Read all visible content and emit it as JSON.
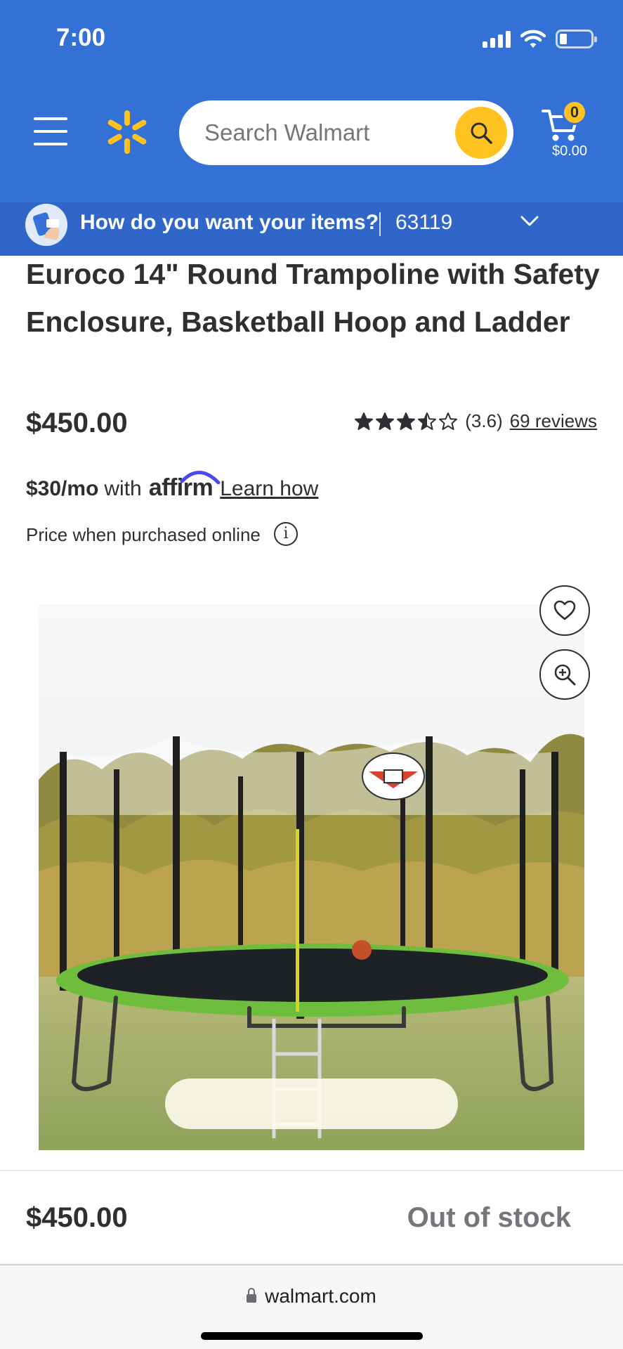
{
  "status_bar": {
    "time": "7:00"
  },
  "header": {
    "search": {
      "placeholder": "Search Walmart"
    },
    "cart": {
      "count": "0",
      "total": "$0.00"
    },
    "delivery": {
      "prompt": "How do you want your items?",
      "zip": "63119"
    },
    "colors": {
      "brand_blue": "#3471d6",
      "spark_yellow": "#ffc220"
    }
  },
  "product": {
    "title": "Euroco 14\" Round Trampoline with Safety Enclosure, Basketball Hoop and Ladder",
    "price": "$450.00",
    "rating": {
      "value": 3.6,
      "max": 5,
      "display": "(3.6)",
      "reviews_link": "69 reviews"
    },
    "financing": {
      "amount": "$30/mo",
      "with": "with",
      "provider": "affirm",
      "link": "Learn how"
    },
    "price_note": "Price when purchased online",
    "info_glyph": "i",
    "image_icons": [
      "heart-icon",
      "zoom-in-icon"
    ]
  },
  "sticky_bar": {
    "price": "$450.00",
    "availability": "Out of stock"
  },
  "browser": {
    "url": "walmart.com"
  }
}
